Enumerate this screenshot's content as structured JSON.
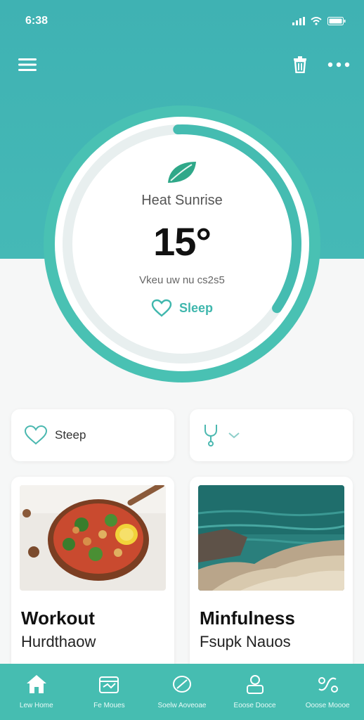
{
  "status_bar": {
    "time": "6:38"
  },
  "header": {
    "menu_icon": "menu-icon",
    "trash_icon": "trash-icon",
    "more_icon": "more-icon"
  },
  "colors": {
    "primary": "#45b9b6",
    "accent": "#3fb7ad",
    "track": "#e8efef"
  },
  "ring": {
    "icon": "leaf-icon",
    "label": "Heat Sunrise",
    "value": "15°",
    "subtitle": "Vkeu uw nu cs2s5",
    "action_label": "Sleep",
    "progress": 0.35
  },
  "quick": {
    "left_label": "Steep",
    "left_icon": "heart-icon",
    "right_icon": "stethoscope-icon"
  },
  "cards": [
    {
      "title": "Workout",
      "subtitle": "Hurdthaow",
      "image": "food-bowl"
    },
    {
      "title": "Minfulness",
      "subtitle": "Fsupk Nauos",
      "image": "ocean-shore"
    }
  ],
  "tabs": [
    {
      "label": "Lew Home",
      "icon": "home-icon"
    },
    {
      "label": "Fe Moues",
      "icon": "calendar-icon"
    },
    {
      "label": "Soelw Aoveoae",
      "icon": "leaf-icon"
    },
    {
      "label": "Eoose Dooce",
      "icon": "profile-icon"
    },
    {
      "label": "Ooose Moooe",
      "icon": "route-icon"
    }
  ]
}
